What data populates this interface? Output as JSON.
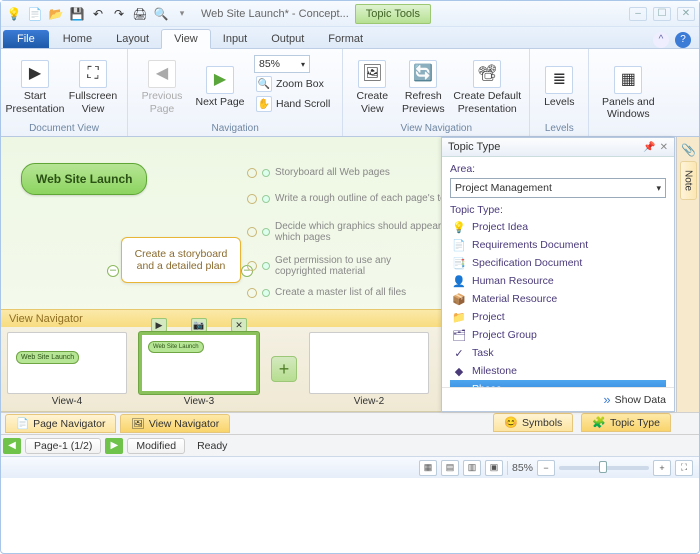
{
  "window": {
    "title": "Web Site Launch* - Concept...",
    "contextualTab": "Topic Tools"
  },
  "tabs": {
    "file": "File",
    "list": [
      "Home",
      "Layout",
      "View",
      "Input",
      "Output",
      "Format"
    ],
    "activeIndex": 2
  },
  "ribbon": {
    "documentView": {
      "label": "Document View",
      "startPresentation": "Start Presentation",
      "fullscreenView": "Fullscreen View"
    },
    "navigation": {
      "label": "Navigation",
      "previousPage": "Previous Page",
      "nextPage": "Next Page",
      "zoomValue": "85%",
      "zoomBox": "Zoom Box",
      "handScroll": "Hand Scroll"
    },
    "viewNavigation": {
      "label": "View Navigation",
      "createView": "Create View",
      "refreshPreviews": "Refresh Previews",
      "createDefaultPresentation": "Create Default Presentation"
    },
    "levels": {
      "label": "Levels",
      "btn": "Levels"
    },
    "windows": {
      "label": "",
      "btn": "Panels and Windows"
    }
  },
  "canvas": {
    "mainTopic": "Web Site Launch",
    "subTopic": "Create a storyboard and a detailed plan",
    "items": [
      "Storyboard all Web pages",
      "Write a rough outline of each page's tex",
      "Decide which graphics should appear which pages",
      "Get permission to use any copyrighted material",
      "Create a master list of all files"
    ]
  },
  "sidePanel": {
    "title": "Topic Type",
    "areaLabel": "Area:",
    "areaValue": "Project Management",
    "listLabel": "Topic Type:",
    "items": [
      {
        "icon": "💡",
        "label": "Project Idea"
      },
      {
        "icon": "📄",
        "label": "Requirements Document"
      },
      {
        "icon": "📑",
        "label": "Specification Document"
      },
      {
        "icon": "👤",
        "label": "Human Resource"
      },
      {
        "icon": "📦",
        "label": "Material Resource"
      },
      {
        "icon": "📁",
        "label": "Project"
      },
      {
        "icon": "🗂",
        "label": "Project Group"
      },
      {
        "icon": "✓",
        "label": "Task"
      },
      {
        "icon": "◆",
        "label": "Milestone"
      },
      {
        "icon": "▬",
        "label": "Phase"
      }
    ],
    "selectedIndex": 9,
    "showData": "Show Data"
  },
  "rightTabs": {
    "note": "Note"
  },
  "viewNavigator": {
    "header": "View Navigator",
    "views": [
      "View-4",
      "View-3",
      "View-2"
    ],
    "selectedIndex": 1,
    "thumbTopic": "Web Site Launch"
  },
  "bottomTabs": {
    "pageNavigator": "Page Navigator",
    "viewNavigator": "View Navigator",
    "symbols": "Symbols",
    "topicType": "Topic Type"
  },
  "pageBar": {
    "page": "Page-1 (1/2)",
    "modified": "Modified",
    "ready": "Ready"
  },
  "status": {
    "zoom": "85%"
  }
}
